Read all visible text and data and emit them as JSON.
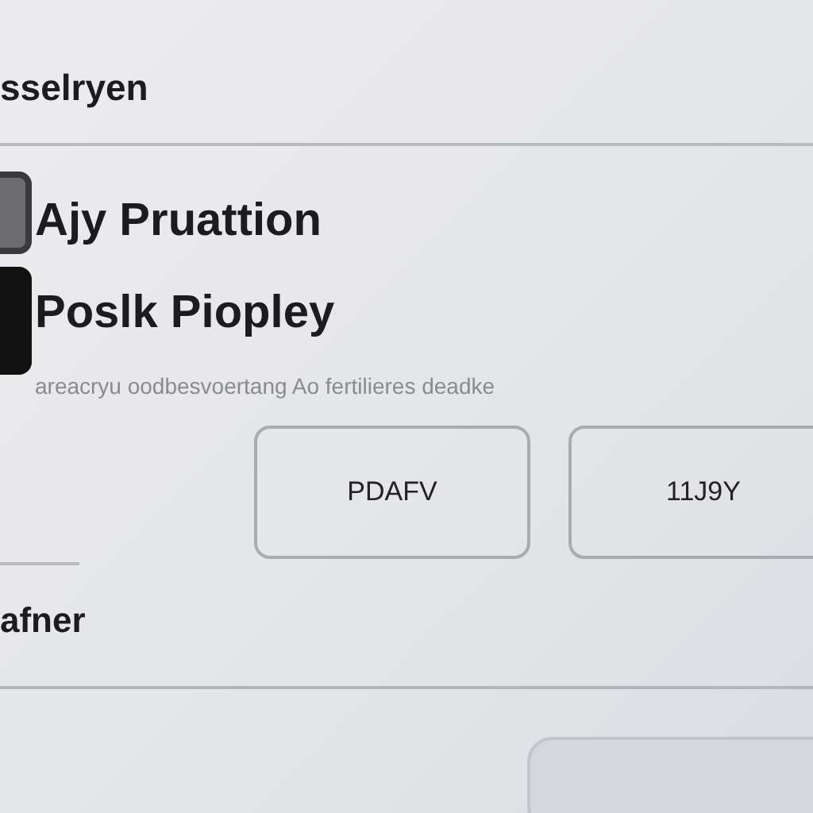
{
  "header": {
    "title": "sselryen"
  },
  "app": {
    "name": "Ajy Pruattion",
    "subtitle": "Poslk Piopley",
    "description": "areacryu oodbesvoertang Ao fertilieres deadke"
  },
  "buttons": [
    {
      "label": "PDAFV"
    },
    {
      "label": "11J9Y"
    }
  ],
  "section": {
    "title": "afner"
  },
  "footer_button": {
    "kind": "blank"
  }
}
